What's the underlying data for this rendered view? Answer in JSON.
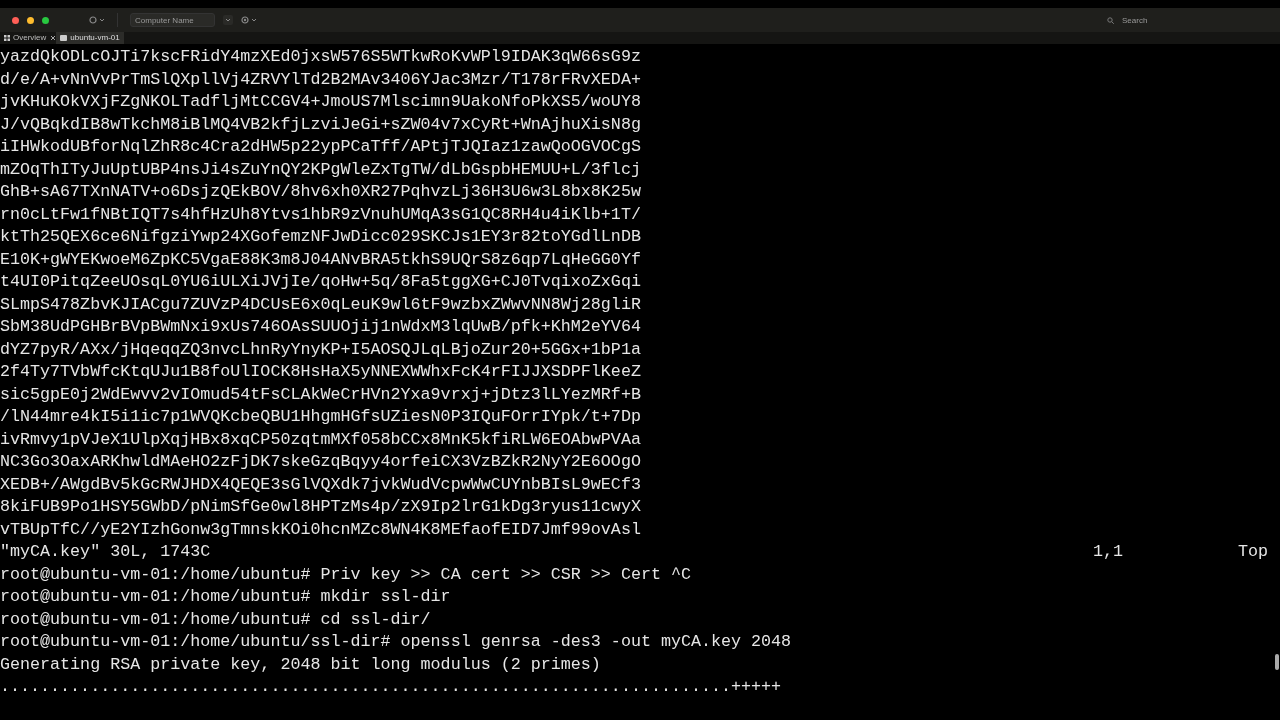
{
  "toolbar": {
    "computer_name": {
      "placeholder": "Computer Name"
    },
    "search": {
      "placeholder": "Search"
    }
  },
  "tabs": [
    {
      "label": "Overview",
      "kind": "overview",
      "selected": false
    },
    {
      "label": "ubuntu-vm-01",
      "kind": "machine",
      "selected": true
    }
  ],
  "terminal": {
    "editor_lines": [
      "yazdQkODLcOJTi7kscFRidY4mzXEd0jxsW576S5WTkwRoKvWPl9IDAK3qW66sG9z",
      "d/e/A+vNnVvPrTmSlQXpllVj4ZRVYlTd2B2MAv3406YJac3Mzr/T178rFRvXEDA+",
      "jvKHuKOkVXjFZgNKOLTadfljMtCCGV4+JmoUS7Mlscimn9UakoNfoPkXS5/woUY8",
      "J/vQBqkdIB8wTkchM8iBlMQ4VB2kfjLzviJeGi+sZW04v7xCyRt+WnAjhuXisN8g",
      "iIHWkodUBforNqlZhR8c4Cra2dHW5p22ypPCaTff/APtjTJQIaz1zawQoOGVOCgS",
      "mZOqThITyJuUptUBP4nsJi4sZuYnQY2KPgWleZxTgTW/dLbGspbHEMUU+L/3flcj",
      "GhB+sA67TXnNATV+o6DsjzQEkBOV/8hv6xh0XR27PqhvzLj36H3U6w3L8bx8K25w",
      "rn0cLtFw1fNBtIQT7s4hfHzUh8Ytvs1hbR9zVnuhUMqA3sG1QC8RH4u4iKlb+1T/",
      "ktTh25QEX6ce6NifgziYwp24XGofemzNFJwDicc029SKCJs1EY3r82toYGdlLnDB",
      "E10K+gWYEKwoeM6ZpKC5VgaE88K3m8J04ANvBRA5tkhS9UQrS8z6qp7LqHeGG0Yf",
      "t4UI0PitqZeeUOsqL0YU6iULXiJVjIe/qoHw+5q/8Fa5tggXG+CJ0TvqixoZxGqi",
      "SLmpS478ZbvKJIACgu7ZUVzP4DCUsE6x0qLeuK9wl6tF9wzbxZWwvNN8Wj28gliR",
      "SbM38UdPGHBrBVpBWmNxi9xUs746OAsSUUOjij1nWdxM3lqUwB/pfk+KhM2eYV64",
      "dYZ7pyR/AXx/jHqeqqZQ3nvcLhnRyYnyKP+I5AOSQJLqLBjoZur20+5GGx+1bP1a",
      "2f4Ty7TVbWfcKtqUJu1B8foUlIOCK8HsHaX5yNNEXWWhxFcK4rFIJJXSDPFlKeeZ",
      "sic5gpE0j2WdEwvv2vIOmud54tFsCLAkWeCrHVn2Yxa9vrxj+jDtz3lLYezMRf+B",
      "/lN44mre4kI5i1ic7p1WVQKcbeQBU1HhgmHGfsUZiesN0P3IQuFOrrIYpk/t+7Dp",
      "ivRmvy1pVJeX1UlpXqjHBx8xqCP50zqtmMXf058bCCx8MnK5kfiRLW6EOAbwPVAa",
      "NC3Go3OaxARKhwldMAeHO2zFjDK7skeGzqBqyy4orfeiCX3VzBZkR2NyY2E6OOgO",
      "XEDB+/AWgdBv5kGcRWJHDX4QEQE3sGlVQXdk7jvkWudVcpwWwCUYnbBIsL9wECf3",
      "8kiFUB9Po1HSY5GWbD/pNimSfGe0wl8HPTzMs4p/zX9Ip2lrG1kDg3ryus11cwyX",
      "vTBUpTfC//yE2YIzhGonw3gTmnskKOi0hcnMZc8WN4K8MEfaofEID7Jmf99ovAsl"
    ],
    "status_line": {
      "file": "\"myCA.key\" 30L, 1743C",
      "cursor": "1,1",
      "scroll": "Top"
    },
    "shell_lines": [
      "root@ubuntu-vm-01:/home/ubuntu# Priv key >> CA cert >> CSR >> Cert ^C",
      "root@ubuntu-vm-01:/home/ubuntu# mkdir ssl-dir",
      "root@ubuntu-vm-01:/home/ubuntu# cd ssl-dir/",
      "root@ubuntu-vm-01:/home/ubuntu/ssl-dir# openssl genrsa -des3 -out myCA.key 2048",
      "Generating RSA private key, 2048 bit long modulus (2 primes)",
      ".........................................................................+++++"
    ]
  }
}
